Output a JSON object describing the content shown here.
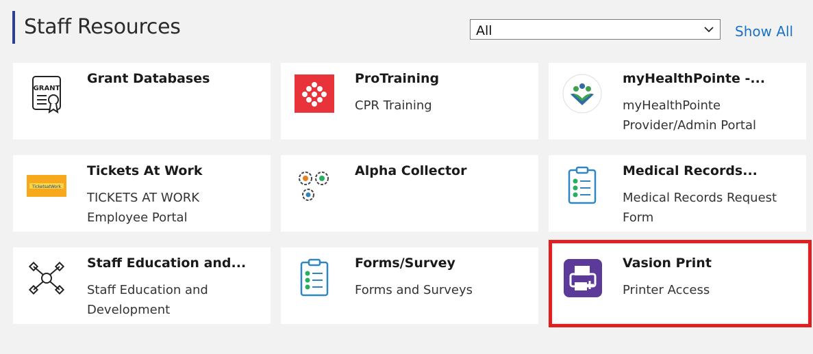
{
  "header": {
    "title": "Staff Resources",
    "filter_value": "All",
    "show_all_label": "Show All"
  },
  "cards": [
    {
      "name": "Grant Databases",
      "desc": "",
      "icon": "grant-certificate-icon"
    },
    {
      "name": "ProTraining",
      "desc": "CPR Training",
      "icon": "protraining-logo-icon"
    },
    {
      "name": "myHealthPointe -...",
      "desc": "myHealthPointe Provider/Admin Portal",
      "icon": "myhealthpointe-logo-icon"
    },
    {
      "name": "Tickets At Work",
      "desc": "TICKETS AT WORK Employee Portal",
      "icon": "tickets-at-work-logo-icon"
    },
    {
      "name": "Alpha Collector",
      "desc": "",
      "icon": "gears-icon"
    },
    {
      "name": "Medical Records...",
      "desc": "Medical Records Request Form",
      "icon": "clipboard-checklist-icon"
    },
    {
      "name": "Staff Education and...",
      "desc": "Staff Education and Development",
      "icon": "teamwork-hands-icon"
    },
    {
      "name": "Forms/Survey",
      "desc": "Forms and Surveys",
      "icon": "clipboard-checklist-icon"
    },
    {
      "name": "Vasion Print",
      "desc": "Printer Access",
      "icon": "printer-icon"
    }
  ],
  "tickets_logo_text": "TicketsatWork",
  "colors": {
    "accent": "#2f3f8f",
    "link": "#1a73c8",
    "highlight": "#e02020",
    "protraining_red": "#e8333a",
    "vasion_purple": "#5b3a99"
  }
}
